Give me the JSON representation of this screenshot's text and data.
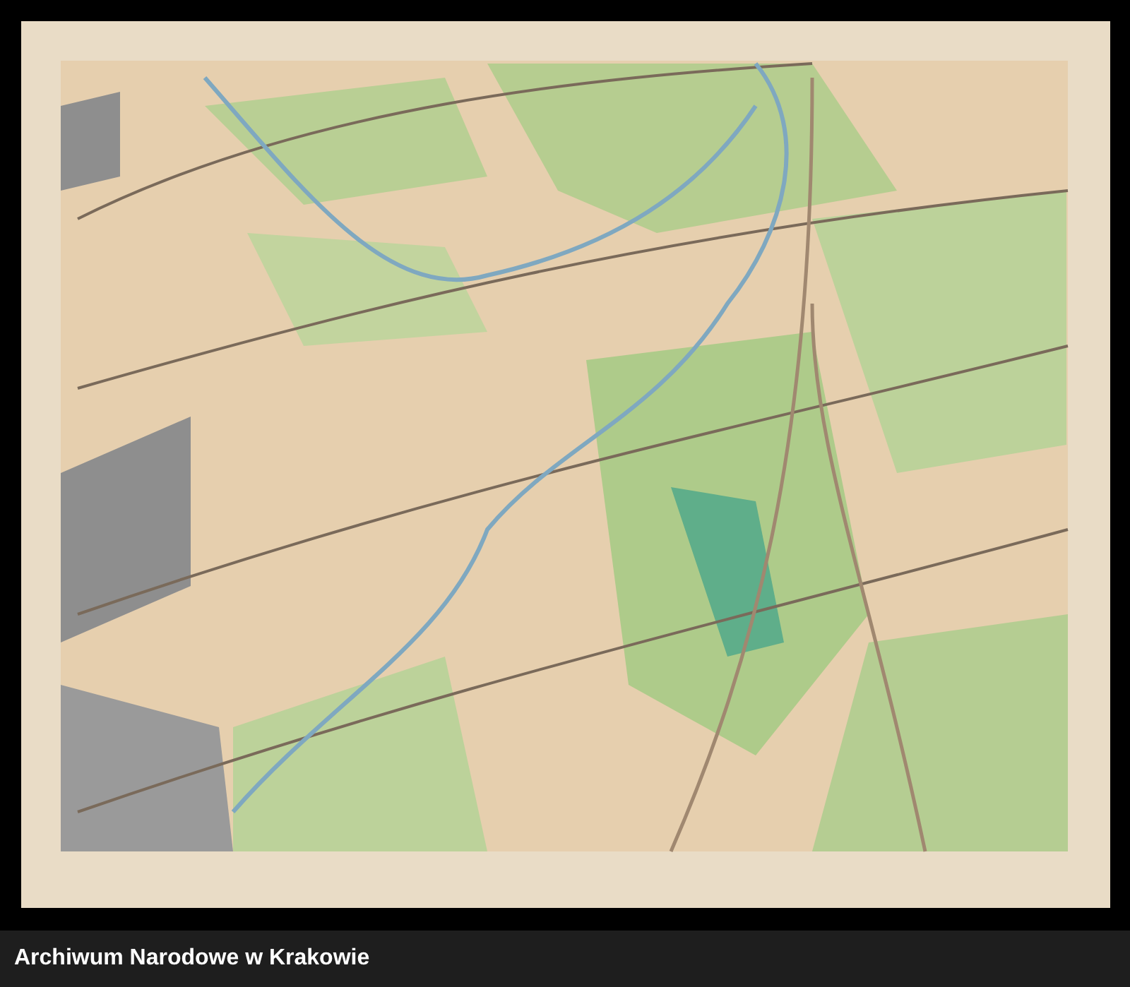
{
  "caption": "Archiwum Narodowe w Krakowie"
}
